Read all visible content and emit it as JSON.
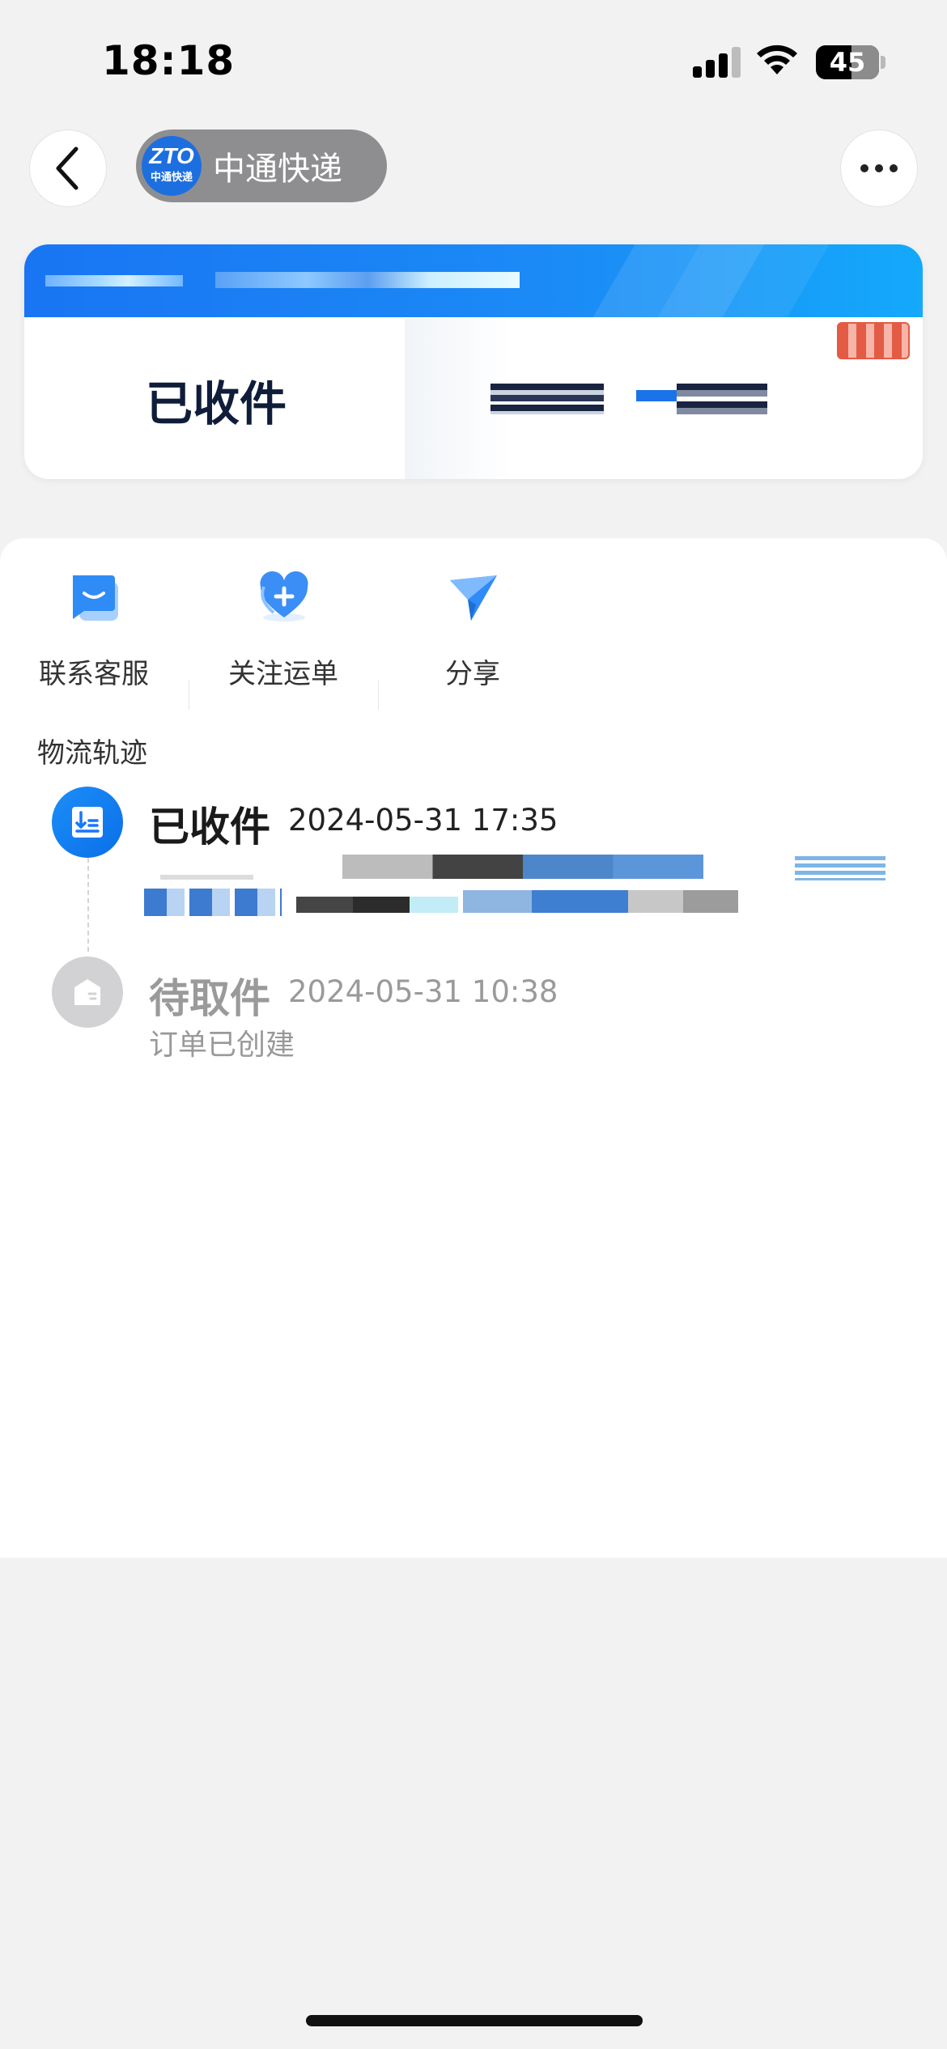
{
  "status_bar": {
    "time": "18:18",
    "battery": "45"
  },
  "nav": {
    "brand_logo_text": "ZTO",
    "brand_logo_sub": "中通快递",
    "brand_name": "中通快递"
  },
  "card": {
    "status": "已收件"
  },
  "actions": [
    {
      "label": "联系客服",
      "icon": "chat-bubble-icon"
    },
    {
      "label": "关注运单",
      "icon": "heart-plus-icon"
    },
    {
      "label": "分享",
      "icon": "paper-plane-icon"
    }
  ],
  "section_title": "物流轨迹",
  "timeline": [
    {
      "status": "已收件",
      "time": "2024-05-31 17:35",
      "description": "",
      "icon": "package-received-icon",
      "active": true
    },
    {
      "status": "待取件",
      "time": "2024-05-31 10:38",
      "description": "订单已创建",
      "icon": "box-icon",
      "active": false
    }
  ],
  "colors": {
    "accent": "#1677ff",
    "background": "#f2f2f3",
    "stamp": "#e35b45"
  }
}
